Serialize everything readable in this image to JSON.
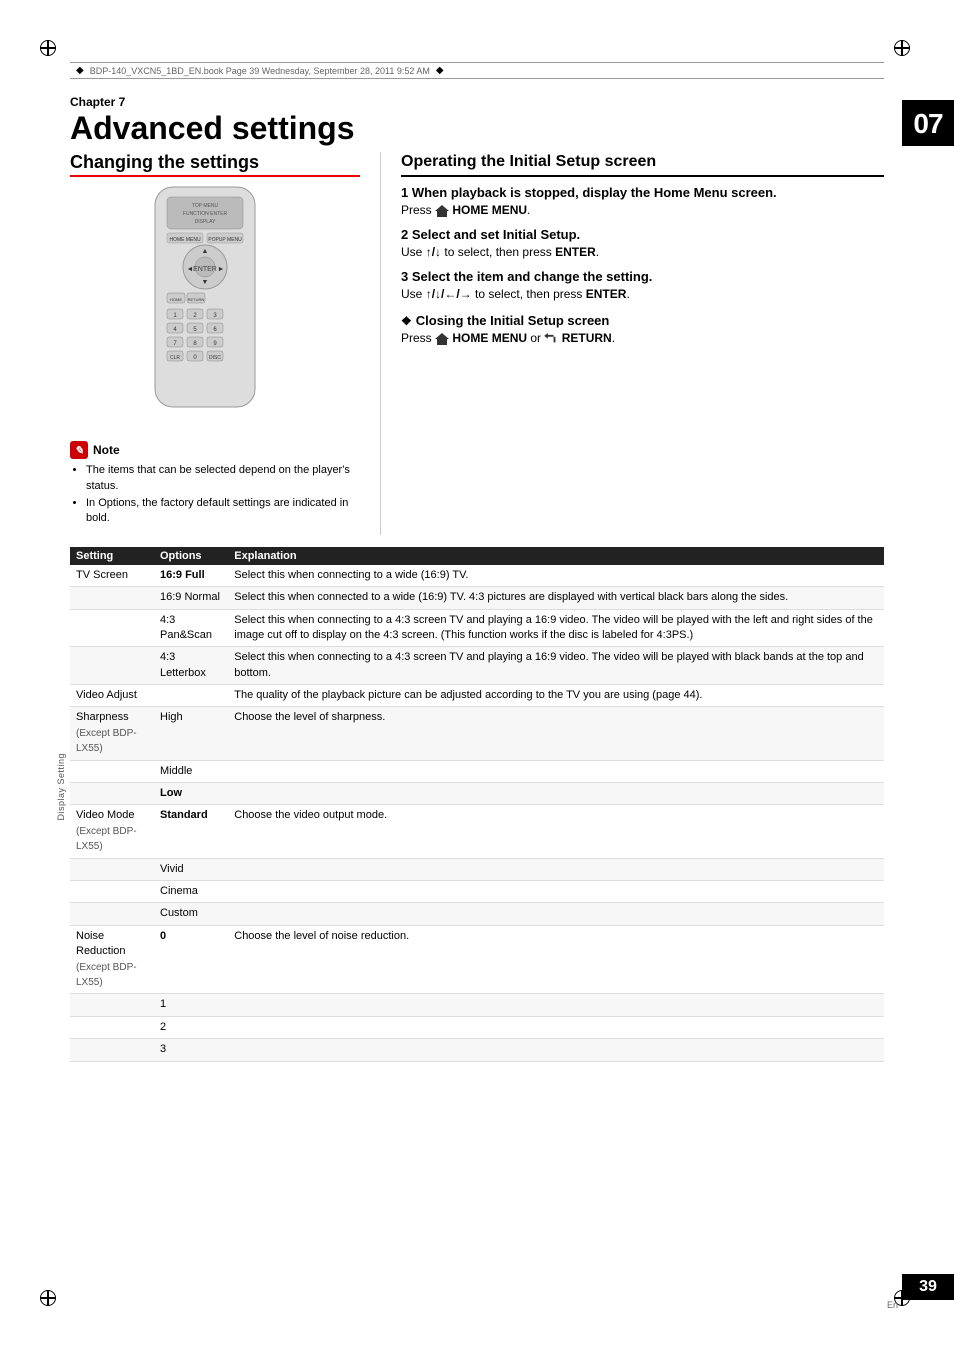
{
  "file_info": "BDP-140_VXCN5_1BD_EN.book  Page 39  Wednesday, September 28, 2011  9:52 AM",
  "chapter": {
    "number": "07",
    "label": "Chapter 7",
    "title": "Advanced settings"
  },
  "left_section": {
    "heading": "Changing the settings"
  },
  "right_section": {
    "heading": "Operating the Initial Setup screen",
    "steps": [
      {
        "num": "1",
        "title": "When playback is stopped, display the Home Menu screen.",
        "body": "Press 🏠 HOME MENU."
      },
      {
        "num": "2",
        "title": "Select and set Initial Setup.",
        "body": "Use ↑/↓ to select, then press ENTER."
      },
      {
        "num": "3",
        "title": "Select the item and change the setting.",
        "body": "Use ↑/↓/←/→ to select, then press ENTER."
      }
    ],
    "closing_section": {
      "diamond_heading": "Closing the Initial Setup screen",
      "body": "Press 🏠 HOME MENU or ↩ RETURN."
    }
  },
  "note": {
    "label": "Note",
    "items": [
      "The items that can be selected depend on the player's status.",
      "In Options, the factory default settings are indicated in bold."
    ]
  },
  "table": {
    "headers": [
      "Setting",
      "Options",
      "Explanation"
    ],
    "side_label": "Display Setting",
    "rows": [
      {
        "setting": "TV Screen",
        "option": "16:9 Full",
        "option_bold": true,
        "explanation": "Select this when connecting to a wide (16:9) TV."
      },
      {
        "setting": "",
        "option": "16:9 Normal",
        "option_bold": false,
        "explanation": "Select this when connected to a wide (16:9) TV. 4:3 pictures are displayed with vertical black bars along the sides."
      },
      {
        "setting": "",
        "option": "4:3 Pan&Scan",
        "option_bold": false,
        "explanation": "Select this when connecting to a 4:3 screen TV and playing a 16:9 video. The video will be played with the left and right sides of the image cut off to display on the 4:3 screen. (This function works if the disc is labeled for 4:3PS.)"
      },
      {
        "setting": "",
        "option": "4:3 Letterbox",
        "option_bold": false,
        "explanation": "Select this when connecting to a 4:3 screen TV and playing a 16:9 video. The video will be played with black bands at the top and bottom."
      },
      {
        "setting": "Video Adjust",
        "option": "",
        "option_bold": false,
        "explanation": "The quality of the playback picture can be adjusted according to the TV you are using (page 44)."
      },
      {
        "setting": "Sharpness",
        "setting2": "(Except BDP-LX55)",
        "option": "High",
        "option_bold": false,
        "explanation": "Choose the level of sharpness."
      },
      {
        "setting": "",
        "option": "Middle",
        "option_bold": false,
        "explanation": ""
      },
      {
        "setting": "",
        "option": "Low",
        "option_bold": true,
        "explanation": ""
      },
      {
        "setting": "Video Mode",
        "setting2": "(Except BDP-LX55)",
        "option": "Standard",
        "option_bold": true,
        "explanation": "Choose the video output mode."
      },
      {
        "setting": "",
        "option": "Vivid",
        "option_bold": false,
        "explanation": ""
      },
      {
        "setting": "",
        "option": "Cinema",
        "option_bold": false,
        "explanation": ""
      },
      {
        "setting": "",
        "option": "Custom",
        "option_bold": false,
        "explanation": ""
      },
      {
        "setting": "Noise Reduction",
        "setting2": "(Except BDP-LX55)",
        "option": "0",
        "option_bold": true,
        "explanation": "Choose the level of noise reduction."
      },
      {
        "setting": "",
        "option": "1",
        "option_bold": false,
        "explanation": ""
      },
      {
        "setting": "",
        "option": "2",
        "option_bold": false,
        "explanation": ""
      },
      {
        "setting": "",
        "option": "3",
        "option_bold": false,
        "explanation": ""
      }
    ]
  },
  "page_number": "39",
  "page_sub": "En"
}
